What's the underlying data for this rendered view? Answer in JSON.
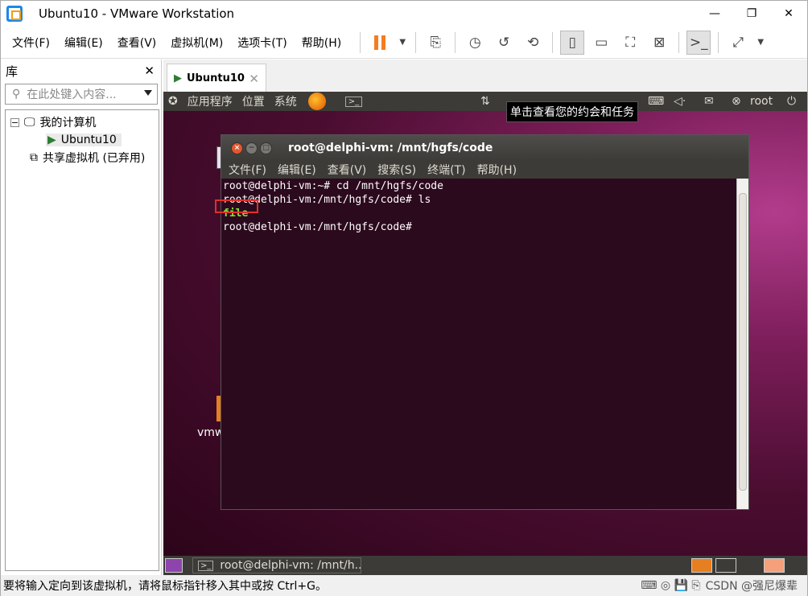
{
  "app": {
    "title": "Ubuntu10 - VMware Workstation"
  },
  "menu": [
    "文件(F)",
    "编辑(E)",
    "查看(V)",
    "虚拟机(M)",
    "选项卡(T)",
    "帮助(H)"
  ],
  "library": {
    "title": "库",
    "search_placeholder": "在此处键入内容...",
    "my_computer": "我的计算机",
    "vm_name": "Ubuntu10",
    "shared": "共享虚拟机 (已弃用)"
  },
  "tab": {
    "label": "Ubuntu10"
  },
  "guest": {
    "panel": {
      "apps": "应用程序",
      "places": "位置",
      "system": "系统",
      "user": "root"
    },
    "tooltip": "单击查看您的约会和任务",
    "desktop_label": "vmw",
    "terminal": {
      "title": "root@delphi-vm: /mnt/hgfs/code",
      "menu": [
        "文件(F)",
        "编辑(E)",
        "查看(V)",
        "搜索(S)",
        "终端(T)",
        "帮助(H)"
      ],
      "lines": [
        "root@delphi-vm:~# cd /mnt/hgfs/code",
        "root@delphi-vm:/mnt/hgfs/code# ls",
        "file",
        "root@delphi-vm:/mnt/hgfs/code#"
      ]
    },
    "taskbar": {
      "item": "root@delphi-vm: /mnt/h..."
    }
  },
  "status": {
    "text": "要将输入定向到该虚拟机，请将鼠标指针移入其中或按 Ctrl+G。",
    "watermark": "CSDN @强尼爆辈"
  }
}
